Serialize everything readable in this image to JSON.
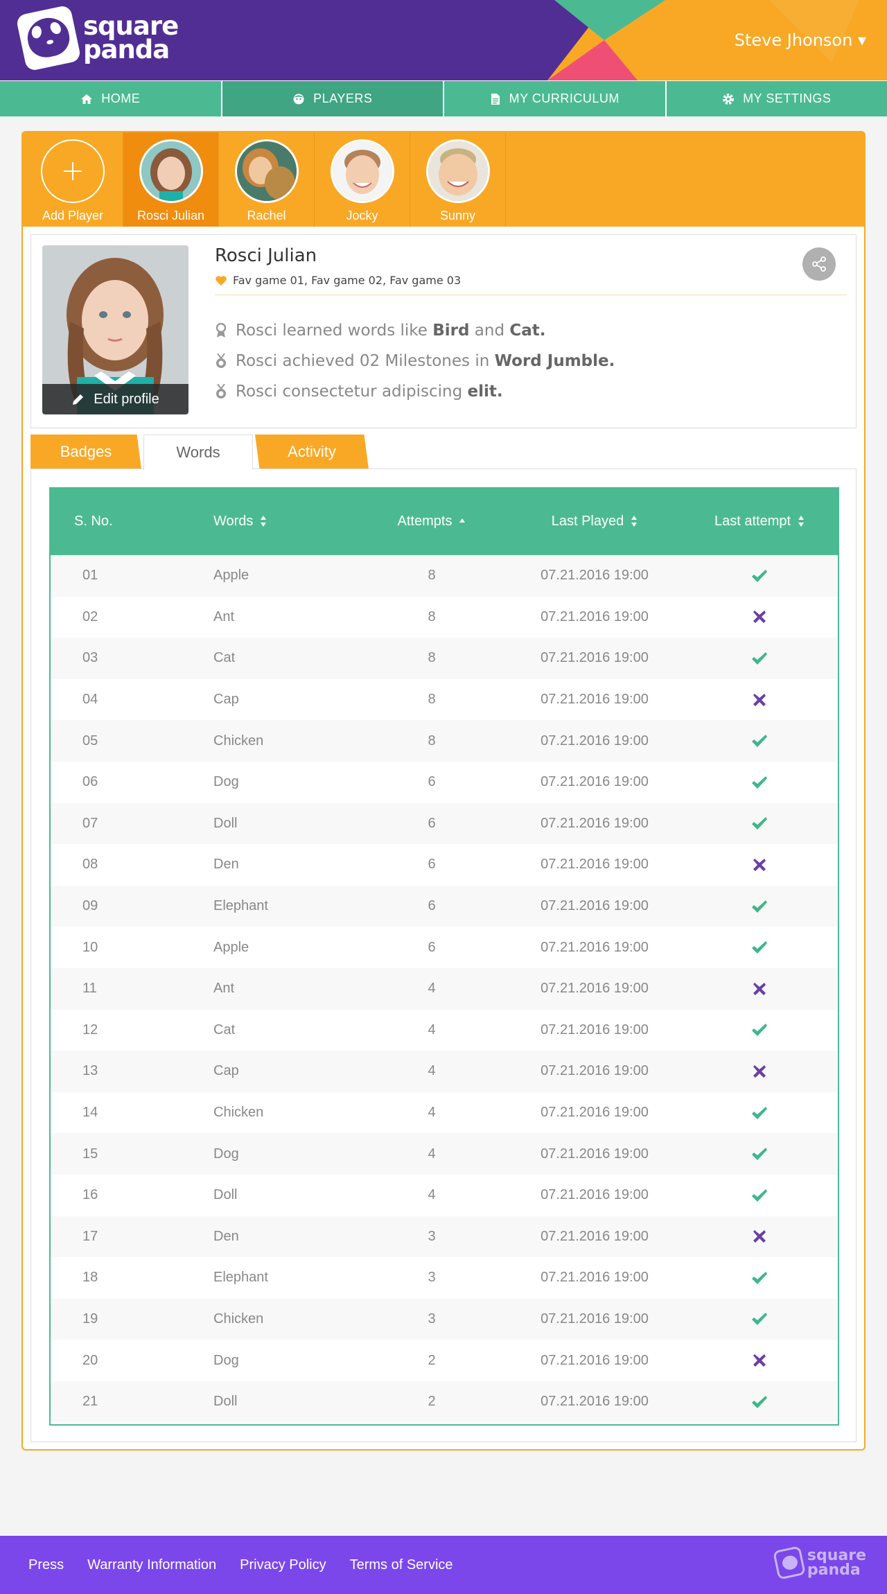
{
  "header": {
    "logo_line1": "square",
    "logo_line2": "panda",
    "user_name": "Steve Jhonson ▾"
  },
  "nav": [
    {
      "label": "HOME",
      "icon": "home-icon"
    },
    {
      "label": "PLAYERS",
      "icon": "face-icon"
    },
    {
      "label": "MY CURRICULUM",
      "icon": "document-icon"
    },
    {
      "label": "MY SETTINGS",
      "icon": "gear-icon"
    }
  ],
  "players": {
    "add_label": "Add Player",
    "list": [
      {
        "name": "Rosci Julian",
        "active": true
      },
      {
        "name": "Rachel"
      },
      {
        "name": "Jocky"
      },
      {
        "name": "Sunny"
      }
    ]
  },
  "profile": {
    "name": "Rosci Julian",
    "fav_games": "Fav game 01, Fav game 02, Fav game 03",
    "edit_label": "Edit profile",
    "fact1": {
      "pre": "Rosci learned words like ",
      "b1": "Bird",
      "mid": " and ",
      "b2": "Cat."
    },
    "fact2": {
      "pre": "Rosci achieved 02 Milestones  in ",
      "b1": "Word Jumble."
    },
    "fact3": {
      "pre": "Rosci consectetur adipiscing ",
      "b1": "elit."
    }
  },
  "tabs": {
    "badges": "Badges",
    "words": "Words",
    "activity": "Activity"
  },
  "table": {
    "headers": {
      "sno": "S. No.",
      "words": "Words",
      "attempts": "Attempts",
      "last_played": "Last Played",
      "last_attempt": "Last attempt"
    },
    "rows": [
      {
        "sno": "01",
        "word": "Apple",
        "attempts": "8",
        "last_played": "07.21.2016 19:00",
        "result": "pass"
      },
      {
        "sno": "02",
        "word": "Ant",
        "attempts": "8",
        "last_played": "07.21.2016 19:00",
        "result": "fail"
      },
      {
        "sno": "03",
        "word": "Cat",
        "attempts": "8",
        "last_played": "07.21.2016 19:00",
        "result": "pass"
      },
      {
        "sno": "04",
        "word": "Cap",
        "attempts": "8",
        "last_played": "07.21.2016 19:00",
        "result": "fail"
      },
      {
        "sno": "05",
        "word": "Chicken",
        "attempts": "8",
        "last_played": "07.21.2016 19:00",
        "result": "pass"
      },
      {
        "sno": "06",
        "word": "Dog",
        "attempts": "6",
        "last_played": "07.21.2016 19:00",
        "result": "pass"
      },
      {
        "sno": "07",
        "word": "Doll",
        "attempts": "6",
        "last_played": "07.21.2016 19:00",
        "result": "pass"
      },
      {
        "sno": "08",
        "word": "Den",
        "attempts": "6",
        "last_played": "07.21.2016 19:00",
        "result": "fail"
      },
      {
        "sno": "09",
        "word": "Elephant",
        "attempts": "6",
        "last_played": "07.21.2016 19:00",
        "result": "pass"
      },
      {
        "sno": "10",
        "word": "Apple",
        "attempts": "6",
        "last_played": "07.21.2016 19:00",
        "result": "pass"
      },
      {
        "sno": "11",
        "word": "Ant",
        "attempts": "4",
        "last_played": "07.21.2016 19:00",
        "result": "fail"
      },
      {
        "sno": "12",
        "word": "Cat",
        "attempts": "4",
        "last_played": "07.21.2016 19:00",
        "result": "pass"
      },
      {
        "sno": "13",
        "word": "Cap",
        "attempts": "4",
        "last_played": "07.21.2016 19:00",
        "result": "fail"
      },
      {
        "sno": "14",
        "word": "Chicken",
        "attempts": "4",
        "last_played": "07.21.2016 19:00",
        "result": "pass"
      },
      {
        "sno": "15",
        "word": "Dog",
        "attempts": "4",
        "last_played": "07.21.2016 19:00",
        "result": "pass"
      },
      {
        "sno": "16",
        "word": "Doll",
        "attempts": "4",
        "last_played": "07.21.2016 19:00",
        "result": "pass"
      },
      {
        "sno": "17",
        "word": "Den",
        "attempts": "3",
        "last_played": "07.21.2016 19:00",
        "result": "fail"
      },
      {
        "sno": "18",
        "word": "Elephant",
        "attempts": "3",
        "last_played": "07.21.2016 19:00",
        "result": "pass"
      },
      {
        "sno": "19",
        "word": "Chicken",
        "attempts": "3",
        "last_played": "07.21.2016 19:00",
        "result": "pass"
      },
      {
        "sno": "20",
        "word": "Dog",
        "attempts": "2",
        "last_played": "07.21.2016 19:00",
        "result": "fail"
      },
      {
        "sno": "21",
        "word": "Doll",
        "attempts": "2",
        "last_played": "07.21.2016 19:00",
        "result": "pass"
      }
    ]
  },
  "footer": {
    "links": [
      "Press",
      "Warranty Information",
      "Privacy Policy",
      "Terms of Service"
    ],
    "logo_line1": "square",
    "logo_line2": "panda"
  },
  "colors": {
    "purple": "#512e94",
    "green": "#4bba93",
    "orange": "#f9a825",
    "pink": "#ef4f75",
    "footer": "#7b47ea"
  }
}
